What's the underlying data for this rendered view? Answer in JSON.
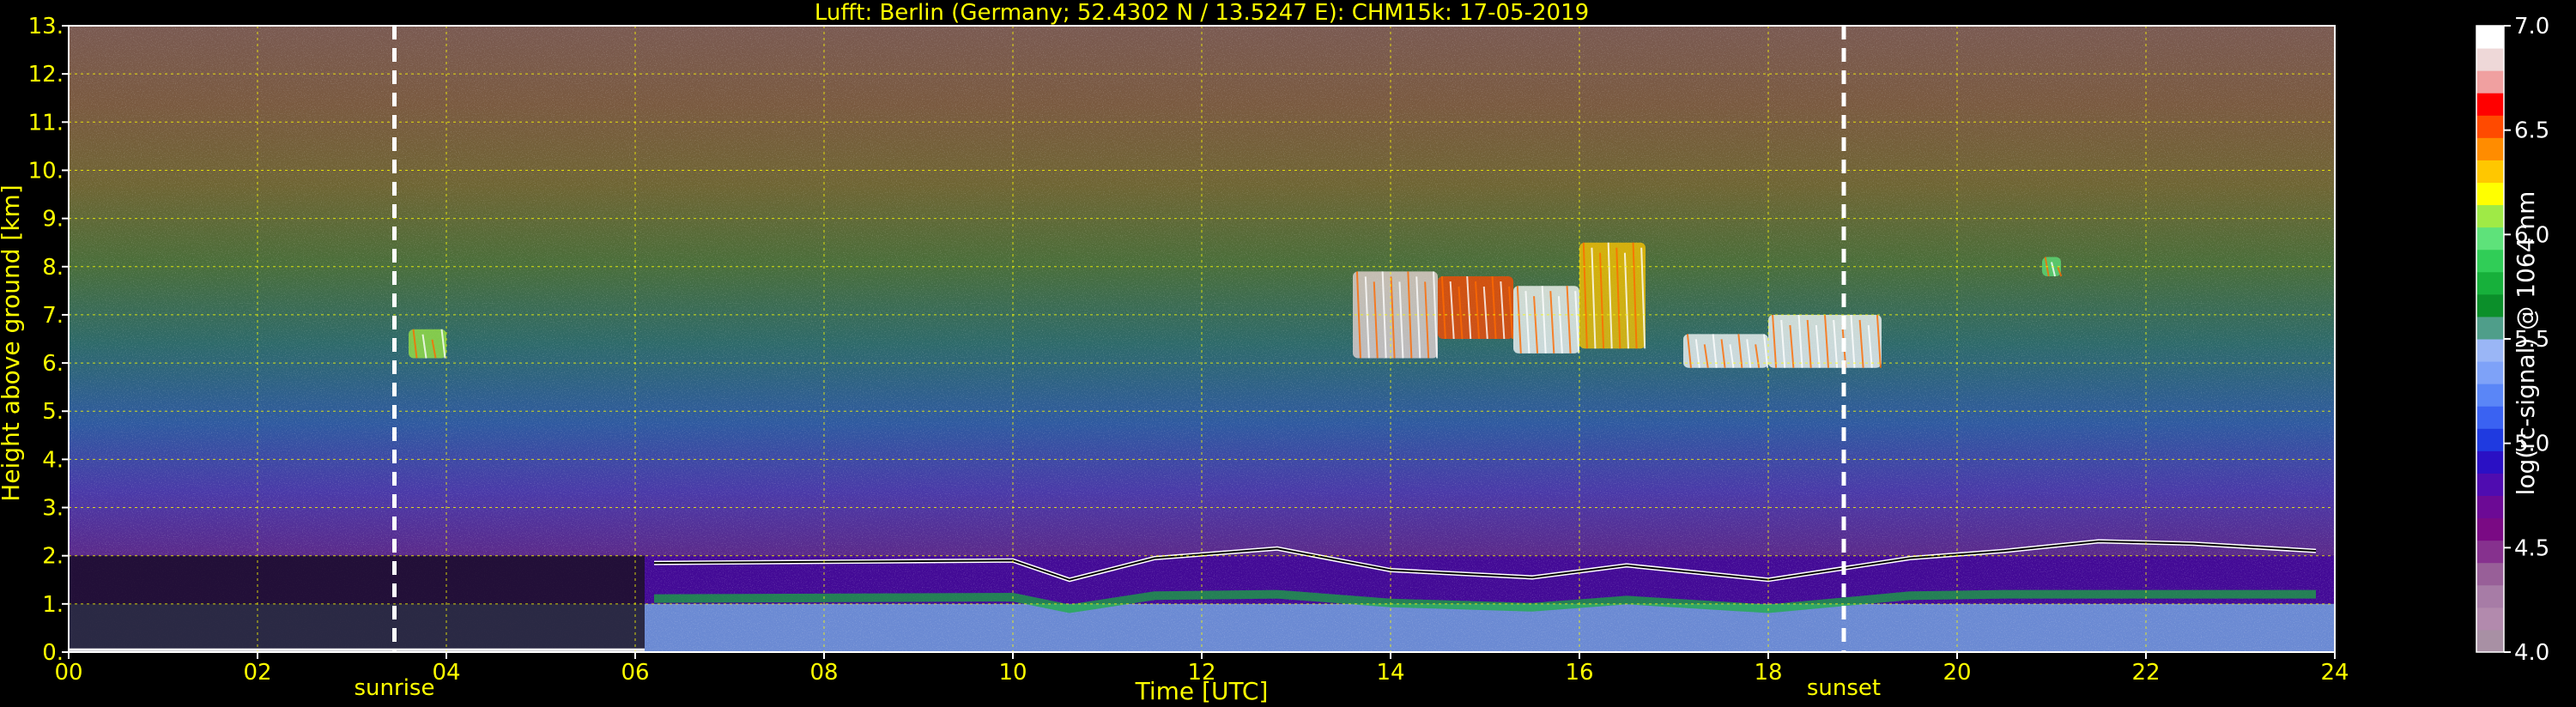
{
  "chart_data": {
    "type": "heatmap",
    "title": "Lufft: Berlin (Germany; 52.4302 N / 13.5247 E):    CHM15k: 17-05-2019",
    "xlabel": "Time [UTC]",
    "ylabel": "Height above ground [km]",
    "xlim": [
      0,
      24
    ],
    "ylim": [
      0,
      13
    ],
    "x_ticks": [
      "00",
      "02",
      "04",
      "06",
      "08",
      "10",
      "12",
      "14",
      "16",
      "18",
      "20",
      "22",
      "24"
    ],
    "y_ticks": [
      "0.",
      "1.",
      "2.",
      "3.",
      "4.",
      "5.",
      "6.",
      "7.",
      "8.",
      "9.",
      "10.",
      "11.",
      "12.",
      "13."
    ],
    "grid": true,
    "events": [
      {
        "label": "sunrise",
        "time": 3.45
      },
      {
        "label": "sunset",
        "time": 18.8
      }
    ],
    "colorbar": {
      "label": "log(rc-signal) @ 1064 nm",
      "range": [
        4.0,
        7.0
      ],
      "ticks": [
        "4.0",
        "4.5",
        "5.0",
        "5.5",
        "6.0",
        "6.5",
        "7.0"
      ],
      "colors": [
        "#a890a4",
        "#b28aad",
        "#a77ca6",
        "#985f98",
        "#86318e",
        "#7a0a84",
        "#6c0a95",
        "#4f0cb0",
        "#2a10c4",
        "#1f3ae0",
        "#3a62f2",
        "#5a86f7",
        "#7ea2f8",
        "#9ab6f6",
        "#4f9e8a",
        "#0b8f2a",
        "#17b03b",
        "#30cd57",
        "#5ee27a",
        "#9fea46",
        "#ffff00",
        "#ffc700",
        "#ff8c00",
        "#ff4a00",
        "#ff0000",
        "#f0a0a0",
        "#eed8d8",
        "#ffffff"
      ]
    },
    "background_layers": [
      {
        "name": "near-noise",
        "from": 2.0,
        "to": 13.0,
        "value": 5.9
      },
      {
        "name": "aerosol-residual",
        "from": 1.0,
        "to": 2.0,
        "value": 4.8
      },
      {
        "name": "boundary-layer",
        "from": 0.0,
        "to": 1.0,
        "value": 5.3
      }
    ],
    "mixing_layer_top": [
      {
        "t": 6.2,
        "h": 1.85
      },
      {
        "t": 10.0,
        "h": 1.9
      },
      {
        "t": 10.6,
        "h": 1.5
      },
      {
        "t": 11.5,
        "h": 1.95
      },
      {
        "t": 12.8,
        "h": 2.15
      },
      {
        "t": 14.0,
        "h": 1.7
      },
      {
        "t": 15.5,
        "h": 1.55
      },
      {
        "t": 16.5,
        "h": 1.8
      },
      {
        "t": 17.5,
        "h": 1.6
      },
      {
        "t": 18.0,
        "h": 1.5
      },
      {
        "t": 19.5,
        "h": 1.95
      },
      {
        "t": 20.5,
        "h": 2.1
      },
      {
        "t": 21.5,
        "h": 2.3
      },
      {
        "t": 22.5,
        "h": 2.25
      },
      {
        "t": 23.8,
        "h": 2.1
      }
    ],
    "cloud_layers": [
      {
        "t_start": 13.6,
        "t_end": 14.5,
        "h_bottom": 6.1,
        "h_top": 7.9,
        "value": 6.8
      },
      {
        "t_start": 14.5,
        "t_end": 15.3,
        "h_bottom": 6.5,
        "h_top": 7.8,
        "value": 6.5
      },
      {
        "t_start": 15.3,
        "t_end": 16.0,
        "h_bottom": 6.2,
        "h_top": 7.6,
        "value": 6.9
      },
      {
        "t_start": 16.0,
        "t_end": 16.7,
        "h_bottom": 6.3,
        "h_top": 8.5,
        "value": 6.3
      },
      {
        "t_start": 17.1,
        "t_end": 18.0,
        "h_bottom": 5.9,
        "h_top": 6.6,
        "value": 6.9
      },
      {
        "t_start": 18.0,
        "t_end": 19.2,
        "h_bottom": 5.9,
        "h_top": 7.0,
        "value": 6.9
      },
      {
        "t_start": 3.6,
        "t_end": 4.0,
        "h_bottom": 6.1,
        "h_top": 6.7,
        "value": 6.1
      },
      {
        "t_start": 20.9,
        "t_end": 21.1,
        "h_bottom": 7.8,
        "h_top": 8.2,
        "value": 6.0
      }
    ],
    "colors": {
      "text": "#ffff00",
      "grid": "#ffff00",
      "event_line": "#ffffff",
      "background": "#000000"
    }
  }
}
